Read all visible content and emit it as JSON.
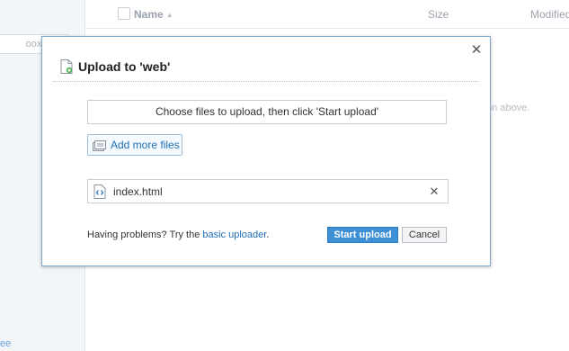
{
  "background": {
    "sidebar_search_placeholder": "oox files",
    "sidebar_footer_text": "ee",
    "columns": {
      "name": "Name",
      "size": "Size",
      "modified": "Modified"
    },
    "hint_text": "ton above."
  },
  "dialog": {
    "title": "Upload to 'web'",
    "drop_zone_text": "Choose files to upload, then click 'Start upload'",
    "add_files_label": "Add more files",
    "files": [
      {
        "name": "index.html",
        "icon": "code-file-icon"
      }
    ],
    "problems_text": "Having problems? Try the ",
    "problems_link": "basic uploader",
    "problems_suffix": ".",
    "start_label": "Start upload",
    "cancel_label": "Cancel"
  },
  "colors": {
    "accent": "#3d8fd6",
    "link": "#1f6fb8",
    "dialog_border": "#7fa8cf"
  }
}
